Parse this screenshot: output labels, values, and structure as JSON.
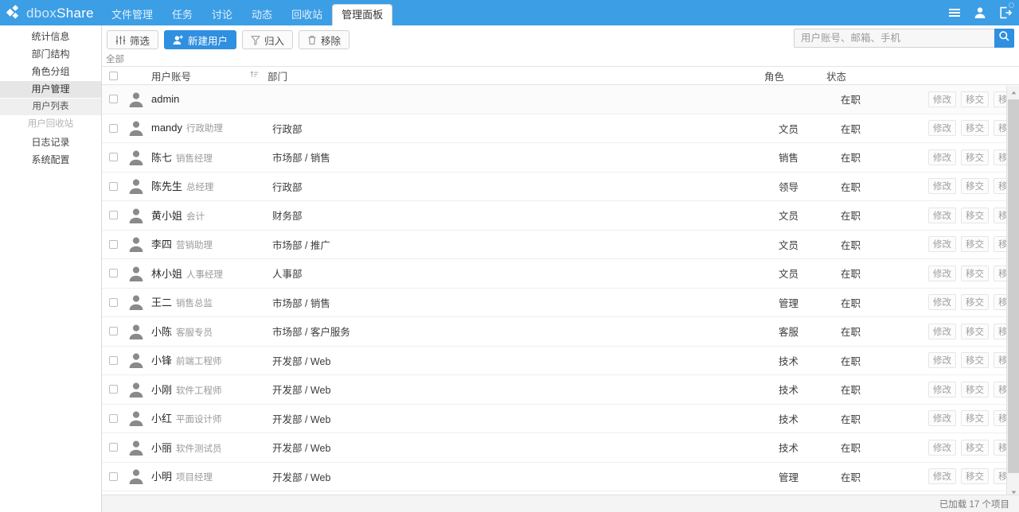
{
  "brand": {
    "name_part1": "dbox",
    "name_part2": "Share",
    "icon": "diamond-cluster-logo"
  },
  "topnav": {
    "items": [
      {
        "label": "文件管理",
        "active": false
      },
      {
        "label": "任务",
        "active": false
      },
      {
        "label": "讨论",
        "active": false
      },
      {
        "label": "动态",
        "active": false
      },
      {
        "label": "回收站",
        "active": false
      },
      {
        "label": "管理面板",
        "active": true
      }
    ],
    "right_icons": [
      "hamburger-menu-icon",
      "user-icon",
      "logout-icon"
    ]
  },
  "sidebar": {
    "items": [
      {
        "label": "统计信息",
        "state": "normal"
      },
      {
        "label": "部门结构",
        "state": "normal"
      },
      {
        "label": "角色分组",
        "state": "normal"
      },
      {
        "label": "用户管理",
        "state": "active"
      },
      {
        "label": "用户列表",
        "state": "sub-selected"
      },
      {
        "label": "用户回收站",
        "state": "sub-disabled"
      },
      {
        "label": "日志记录",
        "state": "normal"
      },
      {
        "label": "系统配置",
        "state": "normal"
      }
    ]
  },
  "toolbar": {
    "filter_label": "筛选",
    "new_user_label": "新建用户",
    "archive_label": "归入",
    "remove_label": "移除"
  },
  "search": {
    "placeholder": "用户账号、邮箱、手机",
    "value": "",
    "icon": "search-icon"
  },
  "tabstrip": {
    "all_label": "全部"
  },
  "table": {
    "headers": {
      "account": "用户账号",
      "department": "部门",
      "role": "角色",
      "status": "状态"
    },
    "row_actions": {
      "edit": "修改",
      "transfer": "移交",
      "remove": "移除"
    },
    "rows": [
      {
        "name": "admin",
        "title": "",
        "department": "",
        "role": "",
        "status": "在职"
      },
      {
        "name": "mandy",
        "title": "行政助理",
        "department": "行政部",
        "role": "文员",
        "status": "在职"
      },
      {
        "name": "陈七",
        "title": "销售经理",
        "department": "市场部 / 销售",
        "role": "销售",
        "status": "在职"
      },
      {
        "name": "陈先生",
        "title": "总经理",
        "department": "行政部",
        "role": "领导",
        "status": "在职"
      },
      {
        "name": "黄小姐",
        "title": "会计",
        "department": "财务部",
        "role": "文员",
        "status": "在职"
      },
      {
        "name": "李四",
        "title": "营销助理",
        "department": "市场部 / 推广",
        "role": "文员",
        "status": "在职"
      },
      {
        "name": "林小姐",
        "title": "人事经理",
        "department": "人事部",
        "role": "文员",
        "status": "在职"
      },
      {
        "name": "王二",
        "title": "销售总监",
        "department": "市场部 / 销售",
        "role": "管理",
        "status": "在职"
      },
      {
        "name": "小陈",
        "title": "客服专员",
        "department": "市场部 / 客户服务",
        "role": "客服",
        "status": "在职"
      },
      {
        "name": "小锋",
        "title": "前端工程师",
        "department": "开发部 / Web",
        "role": "技术",
        "status": "在职"
      },
      {
        "name": "小刚",
        "title": "软件工程师",
        "department": "开发部 / Web",
        "role": "技术",
        "status": "在职"
      },
      {
        "name": "小红",
        "title": "平面设计师",
        "department": "开发部 / Web",
        "role": "技术",
        "status": "在职"
      },
      {
        "name": "小丽",
        "title": "软件测试员",
        "department": "开发部 / Web",
        "role": "技术",
        "status": "在职"
      },
      {
        "name": "小明",
        "title": "项目经理",
        "department": "开发部 / Web",
        "role": "管理",
        "status": "在职"
      }
    ]
  },
  "footer": {
    "status_text": "已加载 17 个项目"
  },
  "colors": {
    "brand_blue": "#3c9ee5",
    "primary_button": "#2f8fe0",
    "active_sidebar": "#e6e6e6"
  }
}
